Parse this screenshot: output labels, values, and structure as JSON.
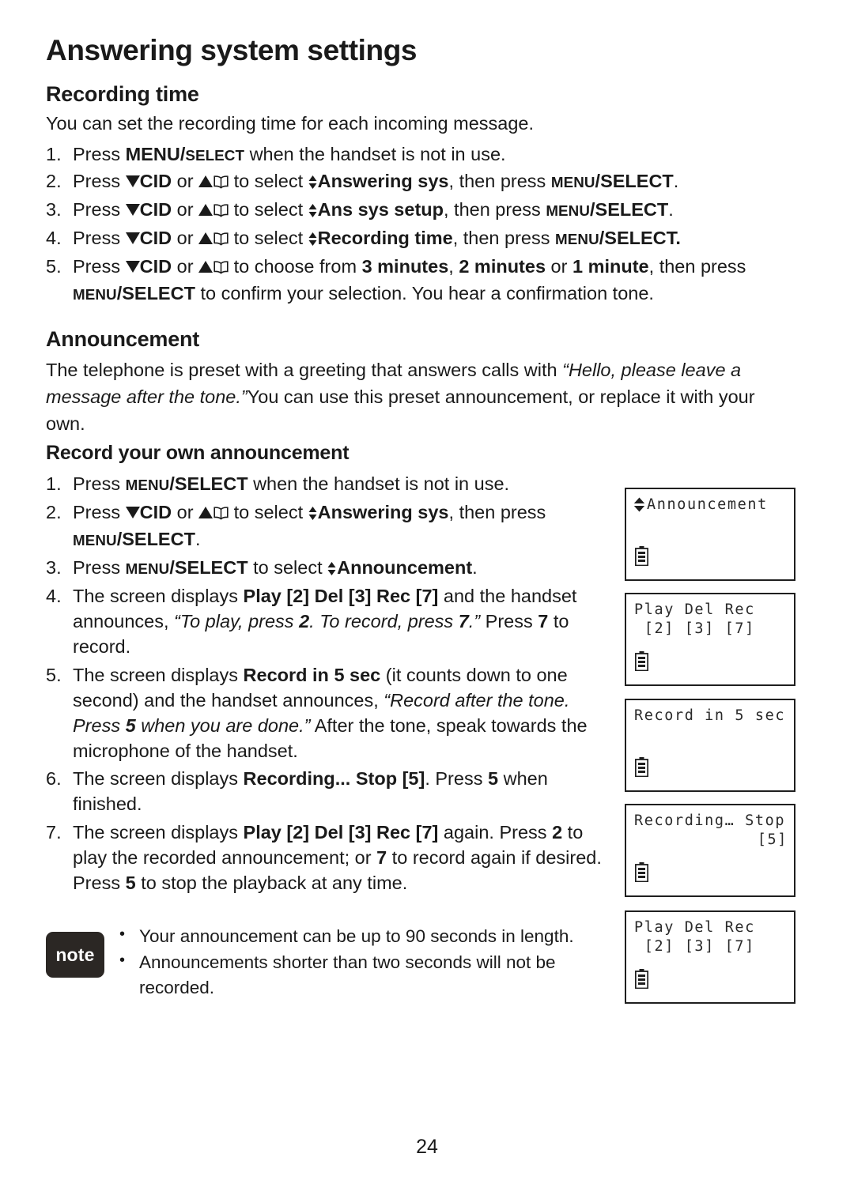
{
  "document": {
    "chapter_title": "Answering system settings",
    "page_number": "24"
  },
  "recording_time": {
    "heading": "Recording time",
    "intro": "You can set the recording time for each incoming message.",
    "steps": [
      {
        "num": "1.",
        "text": "Press MENU/SELECT when the handset is not in use."
      },
      {
        "num": "2.",
        "text": "Press ▼CID or ▲📖 to select ⬍Answering sys, then press MENU/SELECT."
      },
      {
        "num": "3.",
        "text": "Press ▼CID or ▲📖 to select ⬍Ans sys setup, then press MENU/SELECT."
      },
      {
        "num": "4.",
        "text": "Press ▼CID or ▲📖 to select ⬍Recording time, then press MENU/SELECT."
      },
      {
        "num": "5.",
        "text": "Press ▼CID or ▲📖 to choose from 3 minutes, 2 minutes or 1 minute, then press MENU/SELECT to confirm your selection. You hear a confirmation tone."
      }
    ],
    "options": [
      "3 minutes",
      "2 minutes",
      "1 minute"
    ]
  },
  "announcement": {
    "heading": "Announcement",
    "body_part1": "The telephone is preset with a greeting that answers calls with ",
    "preset_greeting": "“Hello, please leave a message after the tone.”",
    "body_part2": "You can use this preset announcement, or replace it with your own.",
    "record_heading": "Record your own announcement",
    "steps": [
      {
        "num": "1.",
        "text": "Press MENU/SELECT when the handset is not in use."
      },
      {
        "num": "2.",
        "text": "Press ▼CID or ▲📖 to select ⬍Answering sys, then press MENU/SELECT."
      },
      {
        "num": "3.",
        "text": "Press MENU/SELECT to select ⬍Announcement."
      },
      {
        "num": "4.",
        "text": "The screen displays Play [2] Del [3] Rec [7] and the handset announces, “To play, press 2. To record, press 7.” Press 7 to record."
      },
      {
        "num": "5.",
        "text": "The screen displays Record in 5 sec (it counts down to one second) and the handset announces, “Record after the tone. Press 5 when you are done.” After the tone, speak towards the microphone of the handset."
      },
      {
        "num": "6.",
        "text": "The screen displays Recording... Stop [5]. Press 5 when finished."
      },
      {
        "num": "7.",
        "text": "The screen displays Play [2] Del [3] Rec [7] again. Press 2 to play the recorded announcement; or 7 to record again if desired. Press 5 to stop the playback at any time."
      }
    ]
  },
  "note": {
    "label": "note",
    "bullets": [
      "Your announcement can be up to 90 seconds in length.",
      "Announcements shorter than two seconds will not be recorded."
    ]
  },
  "lcd_screens": [
    {
      "id": "announcement-menu",
      "selector": true,
      "line1": "Announcement",
      "line2": "",
      "line2_align": "left",
      "battery": true
    },
    {
      "id": "play-del-rec-1",
      "selector": false,
      "line1": "Play Del Rec",
      "line2": " [2] [3] [7]",
      "line2_align": "left",
      "battery": true
    },
    {
      "id": "record-in-5-sec",
      "selector": false,
      "line1": "Record in 5 sec",
      "line2": "",
      "line2_align": "left",
      "battery": true
    },
    {
      "id": "recording-stop",
      "selector": false,
      "line1": "Recording… Stop",
      "line2": "[5]",
      "line2_align": "right",
      "battery": true
    },
    {
      "id": "play-del-rec-2",
      "selector": false,
      "line1": "Play Del Rec",
      "line2": " [2] [3] [7]",
      "line2_align": "left",
      "battery": true
    }
  ],
  "inline_labels": {
    "press": "Press",
    "or": "or",
    "to_select": "to select",
    "to_choose_from": "to choose from",
    "then_press": "then press",
    "cid": "CID",
    "menu": "MENU",
    "select": "SELECT",
    "answering_sys": "Answering sys",
    "ans_sys_setup": "Ans sys setup",
    "recording_time_item": "Recording time",
    "announcement_item": "Announcement",
    "play_del_rec": "Play [2] Del [3] Rec [7]",
    "record_in_5_sec": "Record in 5 sec",
    "recording_stop": "Recording... Stop [5]"
  },
  "colors": {
    "text": "#1a1a1a",
    "note_badge_bg": "#2b2724",
    "lcd_border": "#1f1f1f",
    "lcd_text": "#2a2a2a"
  }
}
